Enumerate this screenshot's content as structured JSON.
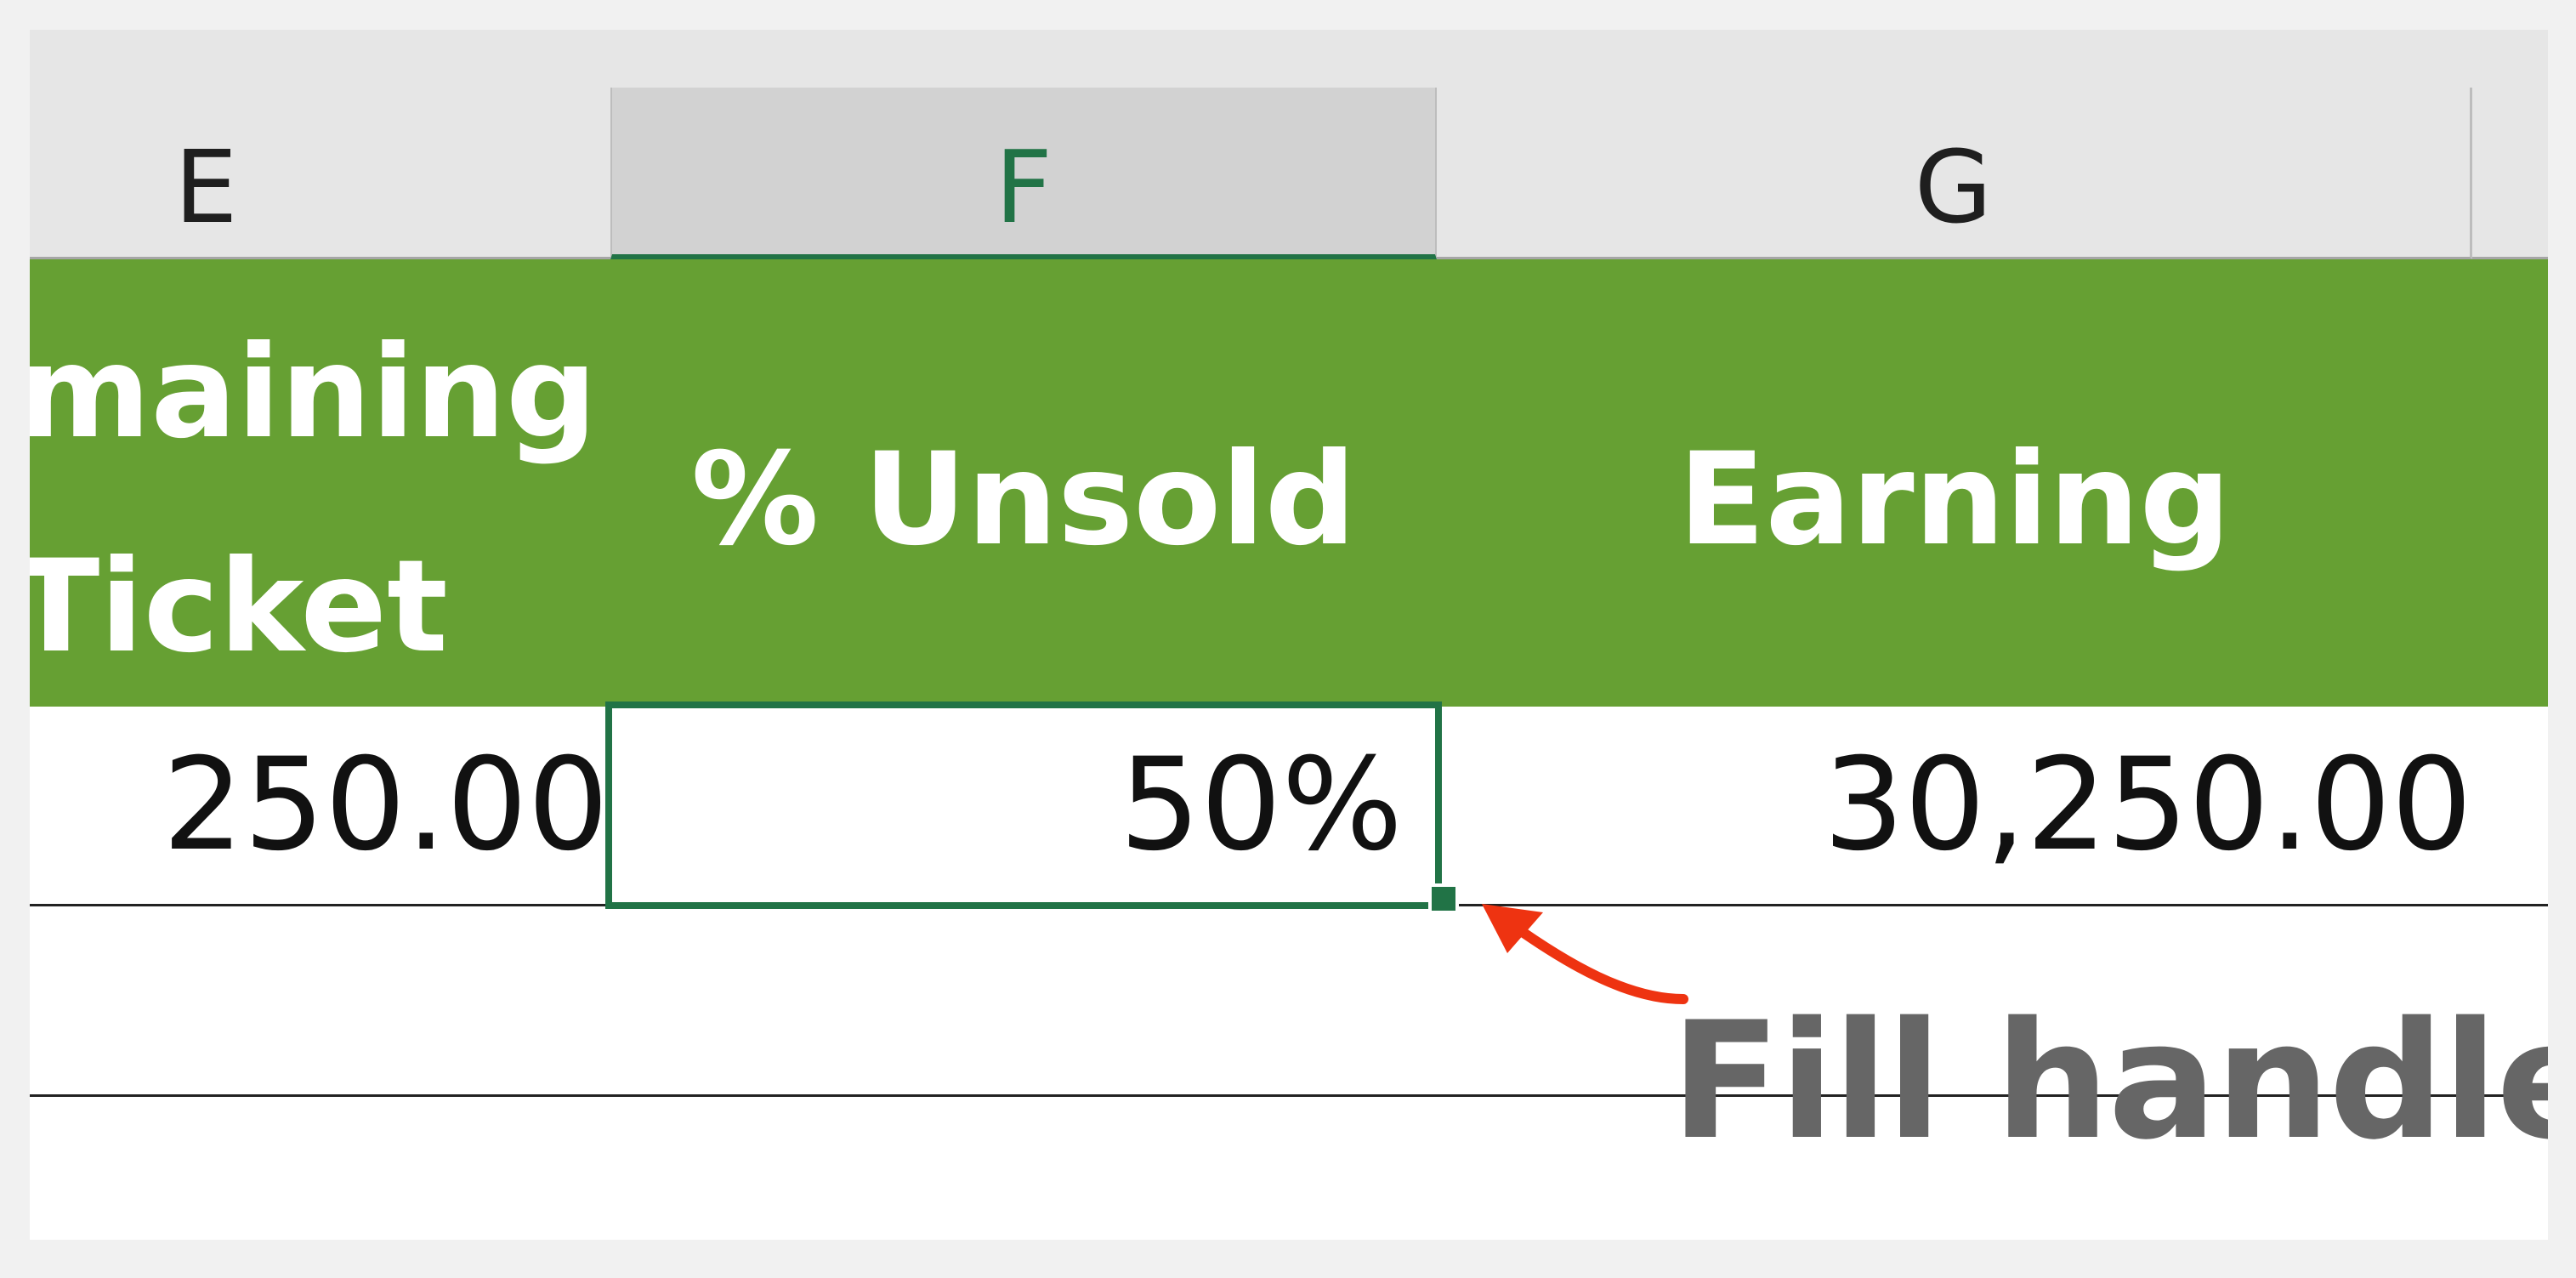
{
  "columns": {
    "e": "E",
    "f": "F",
    "g": "G"
  },
  "header_row": {
    "remaining_line1": "maining",
    "remaining_line2": "Ticket",
    "unsold": "% Unsold",
    "earning": "Earning"
  },
  "data_row": {
    "e_value": "250.00",
    "f_value": "50%",
    "g_value": "30,250.00"
  },
  "annotation": {
    "label": "Fill handle"
  },
  "colors": {
    "header_fill": "#66a033",
    "selection": "#217346",
    "arrow": "#ee3311",
    "annotation_text": "#666666"
  },
  "icons": {
    "arrow": "curved-arrow-icon"
  }
}
